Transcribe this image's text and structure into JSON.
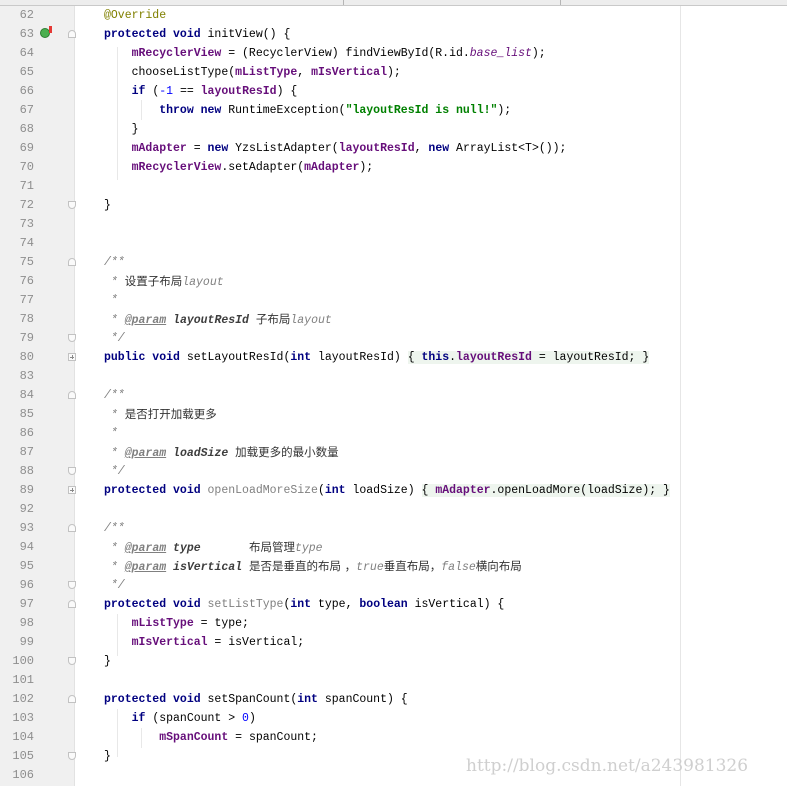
{
  "editor": {
    "lines": [
      {
        "n": "62"
      },
      {
        "n": "63"
      },
      {
        "n": "64"
      },
      {
        "n": "65"
      },
      {
        "n": "66"
      },
      {
        "n": "67"
      },
      {
        "n": "68"
      },
      {
        "n": "69"
      },
      {
        "n": "70"
      },
      {
        "n": "71"
      },
      {
        "n": "72"
      },
      {
        "n": "73"
      },
      {
        "n": "74"
      },
      {
        "n": "75"
      },
      {
        "n": "76"
      },
      {
        "n": "77"
      },
      {
        "n": "78"
      },
      {
        "n": "79"
      },
      {
        "n": "80"
      },
      {
        "n": "83"
      },
      {
        "n": "84"
      },
      {
        "n": "85"
      },
      {
        "n": "86"
      },
      {
        "n": "87"
      },
      {
        "n": "88"
      },
      {
        "n": "89"
      },
      {
        "n": "92"
      },
      {
        "n": "93"
      },
      {
        "n": "94"
      },
      {
        "n": "95"
      },
      {
        "n": "96"
      },
      {
        "n": "97"
      },
      {
        "n": "98"
      },
      {
        "n": "99"
      },
      {
        "n": "100"
      },
      {
        "n": "101"
      },
      {
        "n": "102"
      },
      {
        "n": "103"
      },
      {
        "n": "104"
      },
      {
        "n": "105"
      },
      {
        "n": "106"
      }
    ],
    "watermark": "http://blog.csdn.net/a243981326"
  }
}
